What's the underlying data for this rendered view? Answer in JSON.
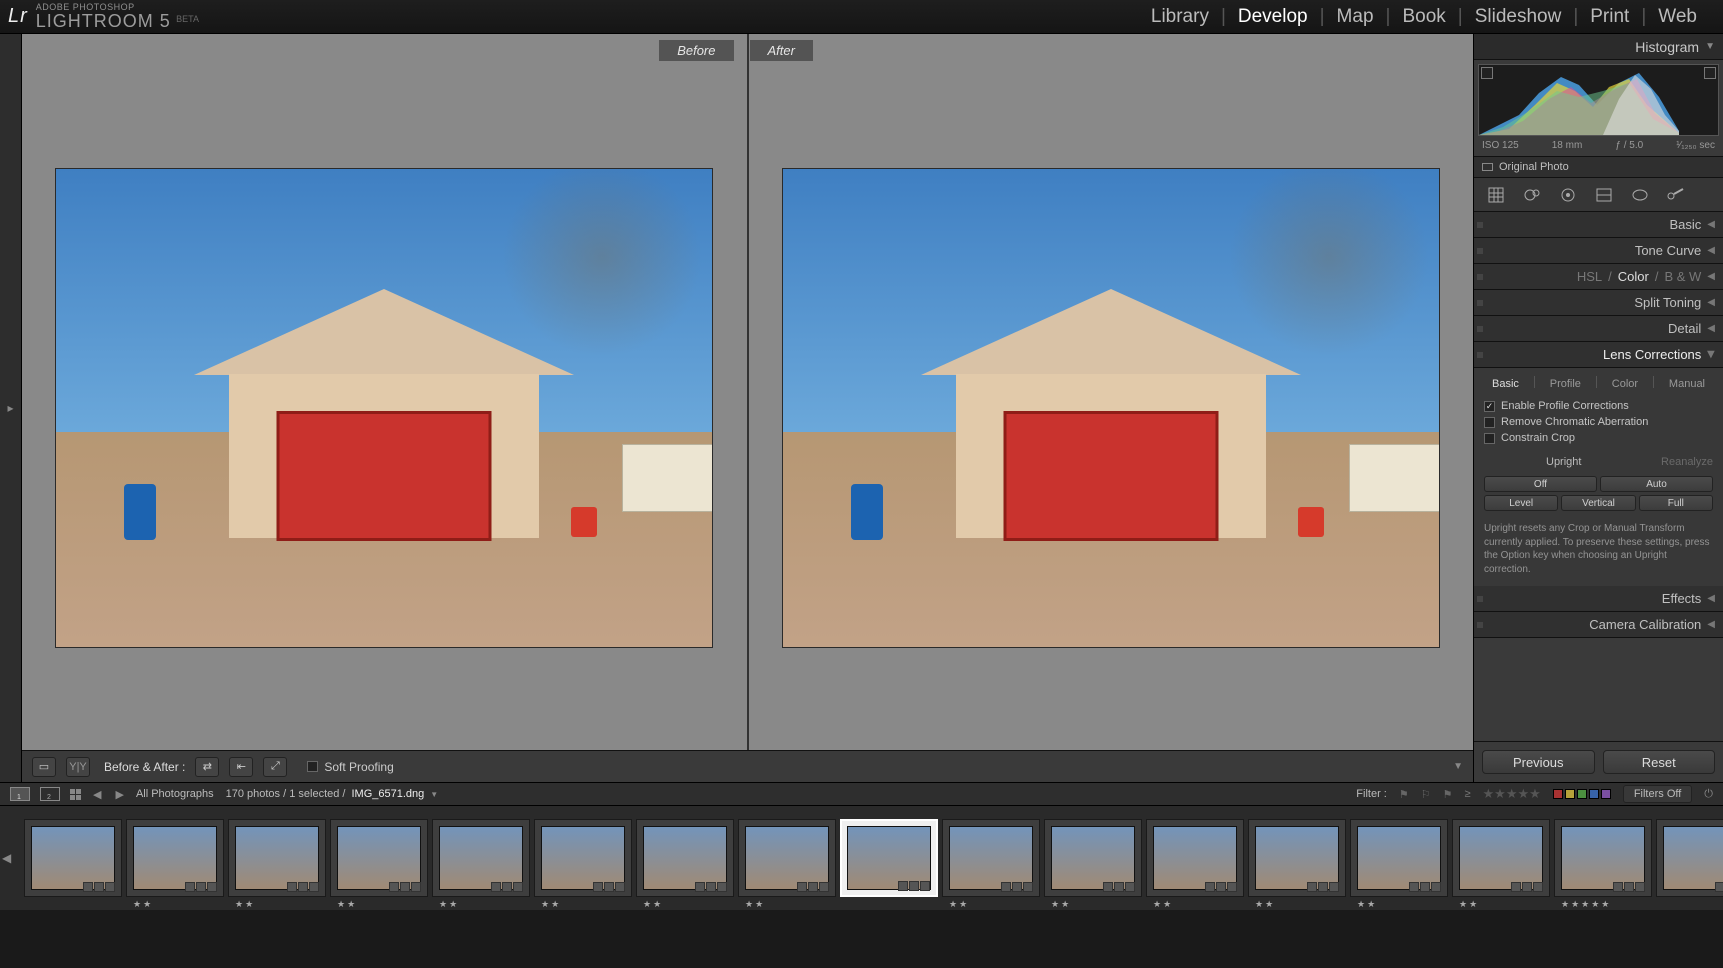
{
  "topbar": {
    "ap": "ADOBE PHOTOSHOP",
    "lr": "LIGHTROOM 5",
    "beta": "BETA",
    "modules": [
      "Library",
      "Develop",
      "Map",
      "Book",
      "Slideshow",
      "Print",
      "Web"
    ],
    "active_module": "Develop"
  },
  "loupe": {
    "before": "Before",
    "after": "After",
    "toolbar": {
      "view_label": "Before & After :",
      "soft_proofing": "Soft Proofing"
    }
  },
  "right": {
    "histogram": {
      "title": "Histogram",
      "iso": "ISO 125",
      "mm": "18 mm",
      "f": "ƒ / 5.0",
      "speed": "¹⁄₁₂₅₀ sec",
      "original": "Original Photo"
    },
    "panels": {
      "basic": "Basic",
      "tone_curve": "Tone Curve",
      "hsl": "HSL",
      "color": "Color",
      "bw": "B & W",
      "split_toning": "Split Toning",
      "detail": "Detail",
      "lens": "Lens Corrections",
      "effects": "Effects",
      "camera_cal": "Camera Calibration"
    },
    "lens": {
      "tabs": [
        "Basic",
        "Profile",
        "Color",
        "Manual"
      ],
      "active_tab": "Basic",
      "enable_profile": "Enable Profile Corrections",
      "remove_chromatic": "Remove Chromatic Aberration",
      "constrain_crop": "Constrain Crop",
      "upright_label": "Upright",
      "reanalyze": "Reanalyze",
      "buttons_row1": [
        "Off",
        "Auto"
      ],
      "buttons_row2": [
        "Level",
        "Vertical",
        "Full"
      ],
      "help": "Upright resets any Crop or Manual Transform currently applied. To preserve these settings, press the Option key when choosing an Upright correction."
    },
    "prev": "Previous",
    "reset": "Reset"
  },
  "filmbar": {
    "source": "All Photographs",
    "count": "170 photos / 1 selected /",
    "filename": "IMG_6571.dng",
    "filter_label": "Filter :",
    "filters_off": "Filters Off"
  },
  "filmstrip": {
    "selected_index": 8,
    "thumbs": [
      {
        "rating": ""
      },
      {
        "rating": "★★"
      },
      {
        "rating": "★★"
      },
      {
        "rating": "★★"
      },
      {
        "rating": "★★"
      },
      {
        "rating": "★★"
      },
      {
        "rating": "★★"
      },
      {
        "rating": "★★"
      },
      {
        "rating": ""
      },
      {
        "rating": "★★"
      },
      {
        "rating": "★★"
      },
      {
        "rating": "★★"
      },
      {
        "rating": "★★"
      },
      {
        "rating": "★★"
      },
      {
        "rating": "★★"
      },
      {
        "rating": "★★★★★"
      },
      {
        "rating": ""
      }
    ]
  }
}
